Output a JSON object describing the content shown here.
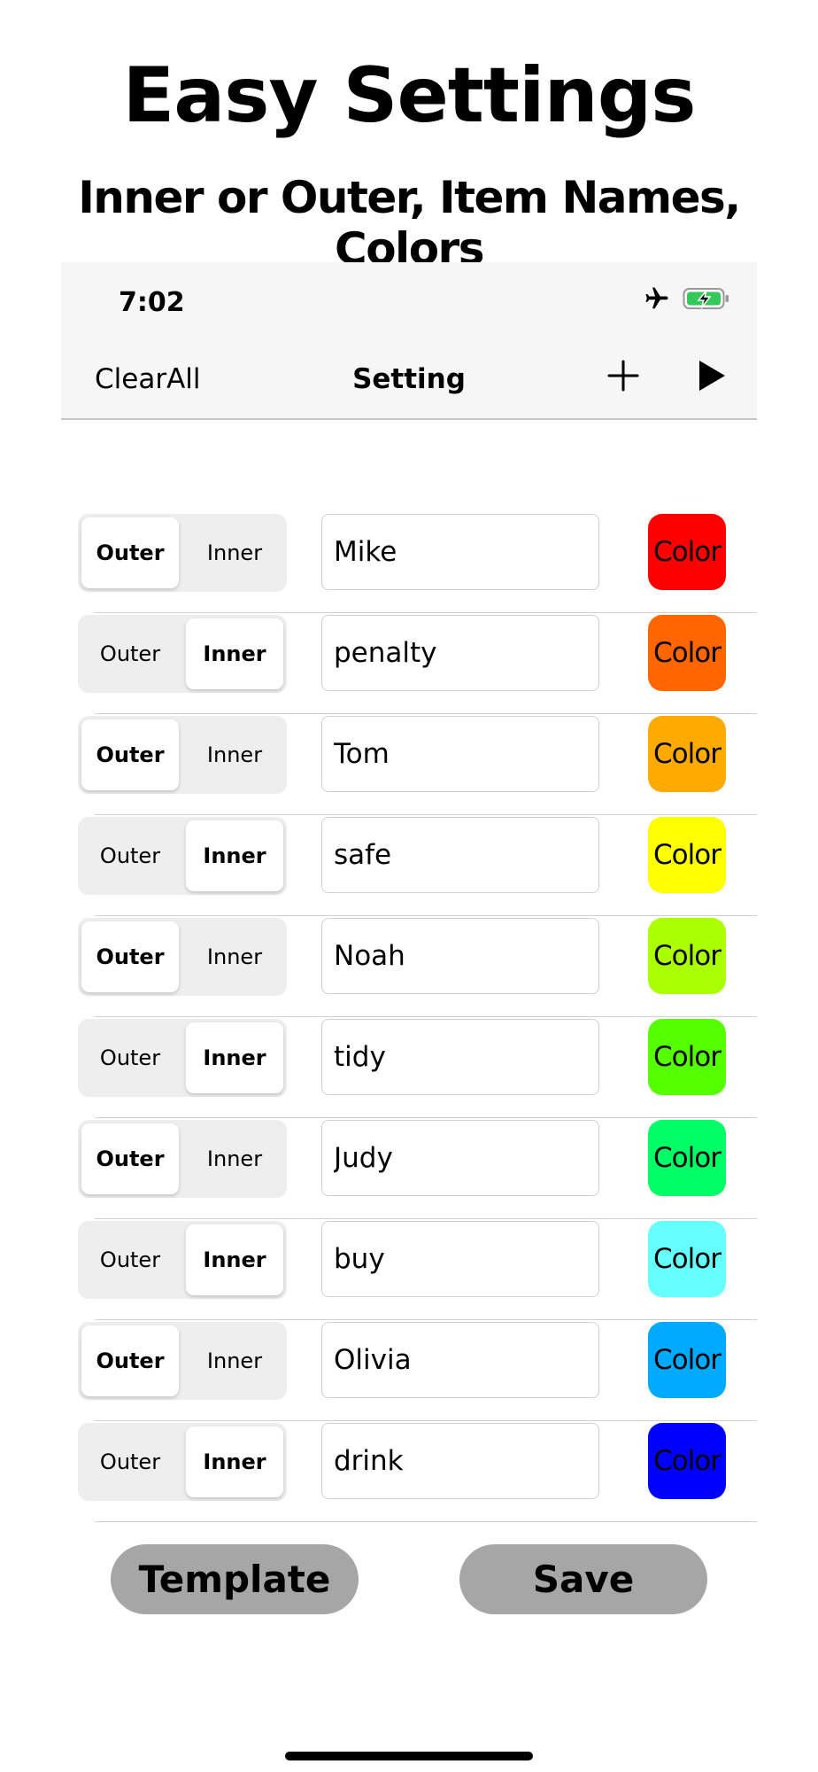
{
  "hero": {
    "title": "Easy Settings",
    "subtitle": "Inner or Outer, Item Names, Colors"
  },
  "status_bar": {
    "time": "7:02",
    "icons": [
      "airplane-icon",
      "battery-charging-icon"
    ]
  },
  "nav": {
    "left_label": "ClearAll",
    "title": "Setting",
    "right_icons": [
      "plus-icon",
      "play-icon"
    ]
  },
  "segment_labels": {
    "outer": "Outer",
    "inner": "Inner"
  },
  "items": [
    {
      "mode": "Outer",
      "name": "Mike",
      "color_label": "Color",
      "color": "#ff0000"
    },
    {
      "mode": "Inner",
      "name": "penalty",
      "color_label": "Color",
      "color": "#ff6600"
    },
    {
      "mode": "Outer",
      "name": "Tom",
      "color_label": "Color",
      "color": "#ffaa00"
    },
    {
      "mode": "Inner",
      "name": "safe",
      "color_label": "Color",
      "color": "#ffff00"
    },
    {
      "mode": "Outer",
      "name": "Noah",
      "color_label": "Color",
      "color": "#aaff00"
    },
    {
      "mode": "Inner",
      "name": "tidy",
      "color_label": "Color",
      "color": "#55ff00"
    },
    {
      "mode": "Outer",
      "name": "Judy",
      "color_label": "Color",
      "color": "#00ff66"
    },
    {
      "mode": "Inner",
      "name": "buy",
      "color_label": "Color",
      "color": "#66ffff"
    },
    {
      "mode": "Outer",
      "name": "Olivia",
      "color_label": "Color",
      "color": "#00aaff"
    },
    {
      "mode": "Inner",
      "name": "drink",
      "color_label": "Color",
      "color": "#0000ff"
    }
  ],
  "buttons": {
    "template": "Template",
    "save": "Save"
  }
}
